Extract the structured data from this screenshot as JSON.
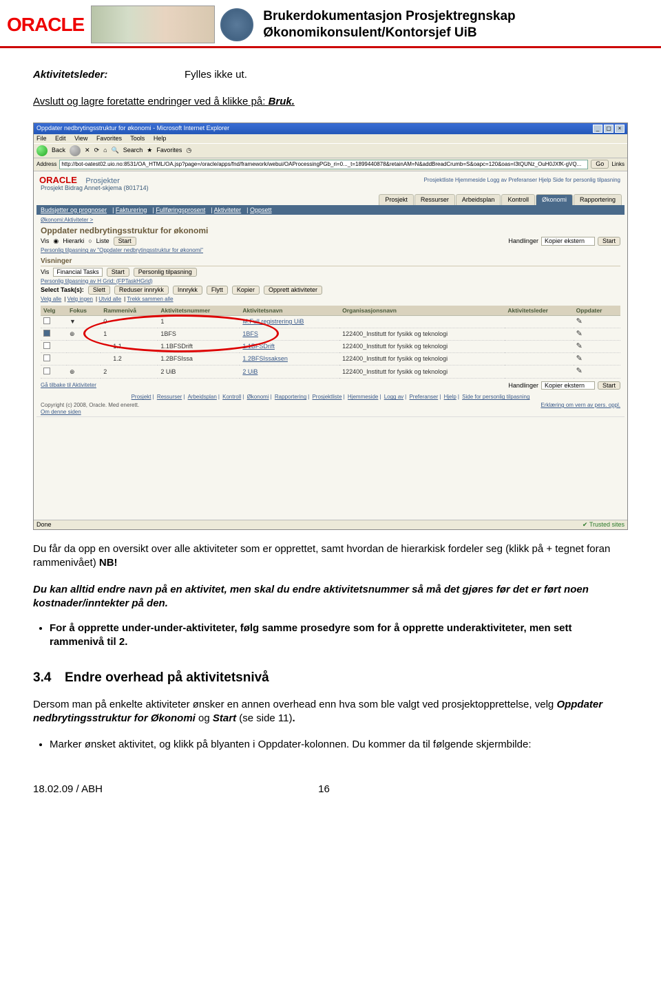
{
  "header": {
    "logo_text": "ORACLE",
    "title_line1": "Brukerdokumentasjon Prosjektregnskap",
    "title_line2": "Økonomikonsulent/Kontorsjef UiB"
  },
  "fields": {
    "aktivitetsleder_label": "Aktivitetsleder:",
    "aktivitetsleder_value": "Fylles ikke ut."
  },
  "instruction": {
    "prefix": "Avslutt og lagre foretatte endringer ved å klikke på: ",
    "action": "Bruk."
  },
  "screenshot": {
    "window_title": "Oppdater nedbrytingsstruktur for økonomi - Microsoft Internet Explorer",
    "menu": [
      "File",
      "Edit",
      "View",
      "Favorites",
      "Tools",
      "Help"
    ],
    "toolbar": {
      "back": "Back",
      "search": "Search",
      "favorites": "Favorites"
    },
    "address_label": "Address",
    "address_value": "http://bot-oatest02.uio.no:8531/OA_HTML/OA.jsp?page=/oracle/apps/fnd/framework/webui/OAProcessingPGb_ri=0..._t=1899440878&retainAM=N&addBreadCrumb=S&oapc=120&oas=I3tQUNz_OuH0JXfK-gVQ...",
    "go_label": "Go",
    "links_label": "Links",
    "oracle_small": "ORACLE",
    "prosjekter": "Prosjekter",
    "prosjekt_sub": "Prosjekt Bidrag Annet-skjema (801714)",
    "toplinks": "Prosjektliste   Hjemmeside   Logg av   Preferanser   Hjelp   Side for personlig tilpasning",
    "tabs": [
      "Prosjekt",
      "Ressurser",
      "Arbeidsplan",
      "Kontroll",
      "Økonomi",
      "Rapportering"
    ],
    "active_tab_index": 4,
    "subtabs": [
      "Budsjetter og prognoser",
      "Fakturering",
      "Fullføringsprosent",
      "Aktiviteter",
      "Oppsett"
    ],
    "crumb": "Økonomi:Aktiviteter  >",
    "page_heading": "Oppdater nedbrytingsstruktur for økonomi",
    "vis_label": "Vis",
    "vis_hierarki": "Hierarki",
    "vis_liste": "Liste",
    "start_btn": "Start",
    "handlinger_label": "Handlinger",
    "handlinger_value": "Kopier ekstern",
    "pers_tilp": "Personlig tilpasning av \"Oppdater nedbrytingsstruktur for økonomi\"",
    "visninger_head": "Visninger",
    "vis2_label": "Vis",
    "vis2_value": "Financial Tasks",
    "pers_tilp_btn": "Personlig tilpasning",
    "hgrid_link": "Personlig tilpasning av H Grid: (FPTaskHGrid)",
    "select_tasks_label": "Select Task(s):",
    "task_btns": [
      "Slett",
      "Reduser innrykk",
      "Innrykk",
      "Flytt",
      "Kopier",
      "Opprett aktiviteter"
    ],
    "linkbar": [
      "Velg alle",
      "Velg ingen",
      "Utvid alle",
      "Trekk sammen alle"
    ],
    "table_headers": [
      "Velg",
      "Fokus",
      "Rammenivå",
      "Aktivitetsnummer",
      "Aktivitetsnavn",
      "Organisasjonsnavn",
      "Aktivitetsleder",
      "Oppdater"
    ],
    "rows": [
      {
        "chk": false,
        "focus": "▼",
        "ram": "0",
        "num": "1",
        "navn": "M.Full registrering UiB",
        "org": "",
        "led": ""
      },
      {
        "chk": true,
        "focus": "⊕",
        "ram": "1",
        "num": "1BFS",
        "navn": "1BFS",
        "org": "122400_Institutt for fysikk og teknologi",
        "led": ""
      },
      {
        "chk": false,
        "focus": "",
        "ram": "1.1",
        "num": "1.1BFSDrift",
        "navn": "1.1BFSDrift",
        "org": "122400_Institutt for fysikk og teknologi",
        "led": ""
      },
      {
        "chk": false,
        "focus": "",
        "ram": "1.2",
        "num": "1.2BFSIssa",
        "navn": "1.2BFSIssaksen",
        "org": "122400_Institutt for fysikk og teknologi",
        "led": ""
      },
      {
        "chk": false,
        "focus": "⊕",
        "ram": "2",
        "num": "2 UiB",
        "navn": "2 UiB",
        "org": "122400_Institutt for fysikk og teknologi",
        "led": ""
      }
    ],
    "back_link": "Gå tilbake til Aktiviteter",
    "bottomlinks": [
      "Prosjekt",
      "Ressurser",
      "Arbeidsplan",
      "Kontroll",
      "Økonomi",
      "Rapportering",
      "Prosjektliste",
      "Hjemmeside",
      "Logg av",
      "Preferanser",
      "Hjelp",
      "Side for personlig tilpasning"
    ],
    "copyright": "Copyright (c) 2008, Oracle. Med enerett.",
    "om_siden": "Om denne siden",
    "erklaering": "Erklæring om vern av pers. oppl.",
    "done": "Done",
    "trusted": "Trusted sites"
  },
  "body_text": {
    "p1_pre": "Du får da opp en oversikt over alle aktiviteter som er opprettet, samt hvordan de hierarkisk fordeler seg (klikk på + tegnet foran rammenivået) ",
    "p1_nb": "NB!",
    "nb_text": "Du kan alltid endre navn på en aktivitet, men skal du endre aktivitetsnummer så må det gjøres før det er ført noen kostnader/inntekter på den.",
    "bullet1": "For å opprette under-under-aktiviteter, følg samme prosedyre som for å opprette underaktiviteter, men sett rammenivå til 2."
  },
  "section34": {
    "number": "3.4",
    "title": "Endre overhead på aktivitetsnivå",
    "p1_a": "Dersom man på enkelte aktiviteter ønsker en annen overhead enn hva som ble valgt ved prosjektopprettelse, velg ",
    "p1_b": "Oppdater nedbrytingsstruktur for Økonomi",
    "p1_c": " og ",
    "p1_d": "Start",
    "p1_e": " (se side 11)",
    "p1_f": ".",
    "bullet_a": "Marker ønsket aktivitet, og klikk på blyanten i ",
    "bullet_b": "Oppdater",
    "bullet_c": "-kolonnen. Du kommer da til følgende skjermbilde:"
  },
  "footer": {
    "left": "18.02.09 / ABH",
    "page": "16"
  }
}
